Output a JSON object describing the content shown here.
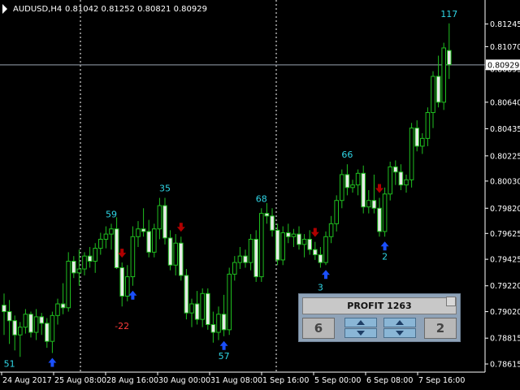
{
  "header": {
    "symbol": "AUDUSD,H4",
    "ohlc": "0.81042 0.81252 0.80821 0.80929"
  },
  "current_price": "0.80929",
  "price_axis": {
    "min": 0.78615,
    "max": 0.81305,
    "ticks": [
      "0.81245",
      "0.81070",
      "0.80895",
      "0.80640",
      "0.80435",
      "0.80225",
      "0.80030",
      "0.79820",
      "0.79625",
      "0.79425",
      "0.79220",
      "0.79020",
      "0.78815",
      "0.78615"
    ],
    "current": 0.80929
  },
  "time_axis": {
    "labels": [
      "24 Aug 2017",
      "25 Aug 08:00",
      "28 Aug 16:00",
      "30 Aug 00:00",
      "31 Aug 08:00",
      "1 Sep 16:00",
      "5 Sep 00:00",
      "6 Sep 08:00",
      "7 Sep 16:00"
    ]
  },
  "signals": [
    {
      "label": "51",
      "type": "pos",
      "bar": 1
    },
    {
      "label": "59",
      "type": "pos",
      "bar": 20
    },
    {
      "label": "-22",
      "type": "neg",
      "bar": 22
    },
    {
      "label": "35",
      "type": "pos",
      "bar": 30
    },
    {
      "label": "57",
      "type": "pos",
      "bar": 41
    },
    {
      "label": "68",
      "type": "pos",
      "bar": 48
    },
    {
      "label": "3",
      "type": "pos",
      "bar": 59
    },
    {
      "label": "66",
      "type": "pos",
      "bar": 64
    },
    {
      "label": "2",
      "type": "pos",
      "bar": 71
    },
    {
      "label": "117",
      "type": "pos",
      "bar": 83
    }
  ],
  "arrows": [
    {
      "dir": "up",
      "bar": 9
    },
    {
      "dir": "down",
      "bar": 22
    },
    {
      "dir": "up",
      "bar": 24
    },
    {
      "dir": "down",
      "bar": 33
    },
    {
      "dir": "up",
      "bar": 41
    },
    {
      "dir": "down",
      "bar": 58
    },
    {
      "dir": "up",
      "bar": 60
    },
    {
      "dir": "down",
      "bar": 70
    },
    {
      "dir": "up",
      "bar": 71
    }
  ],
  "panel": {
    "title": "PROFIT 1263",
    "left_value": "6",
    "right_value": "2"
  },
  "colors": {
    "bull": "#1fbf1f",
    "bear": "#e8e8e8",
    "wick": "#1fbf1f",
    "up_arrow": "#1a4fff",
    "down_arrow": "#b00000",
    "label_pos": "#2fd6e6",
    "label_neg": "#ff3b3b"
  },
  "chart_data": {
    "type": "candlestick",
    "candles": [
      [
        0.7907,
        0.7916,
        0.7884,
        0.7902
      ],
      [
        0.7902,
        0.7911,
        0.7877,
        0.7895
      ],
      [
        0.7895,
        0.7899,
        0.7872,
        0.7884
      ],
      [
        0.7884,
        0.7894,
        0.7867,
        0.789
      ],
      [
        0.789,
        0.7904,
        0.7885,
        0.79
      ],
      [
        0.79,
        0.7902,
        0.7882,
        0.7886
      ],
      [
        0.7886,
        0.7904,
        0.788,
        0.7898
      ],
      [
        0.7898,
        0.7901,
        0.7884,
        0.7893
      ],
      [
        0.7893,
        0.7897,
        0.7874,
        0.7879
      ],
      [
        0.7879,
        0.7902,
        0.787,
        0.7899
      ],
      [
        0.7899,
        0.7912,
        0.7892,
        0.7908
      ],
      [
        0.7908,
        0.7924,
        0.79,
        0.7905
      ],
      [
        0.7905,
        0.7948,
        0.7902,
        0.7941
      ],
      [
        0.7941,
        0.7945,
        0.7928,
        0.7932
      ],
      [
        0.7932,
        0.795,
        0.7922,
        0.7935
      ],
      [
        0.7935,
        0.7948,
        0.793,
        0.7945
      ],
      [
        0.7945,
        0.7952,
        0.7936,
        0.7941
      ],
      [
        0.7941,
        0.7955,
        0.7932,
        0.7951
      ],
      [
        0.7951,
        0.7963,
        0.7946,
        0.7958
      ],
      [
        0.7958,
        0.7968,
        0.7951,
        0.7962
      ],
      [
        0.7962,
        0.797,
        0.795,
        0.7966
      ],
      [
        0.7966,
        0.7975,
        0.7935,
        0.7936
      ],
      [
        0.7936,
        0.794,
        0.7906,
        0.7914
      ],
      [
        0.7914,
        0.7938,
        0.791,
        0.7929
      ],
      [
        0.7929,
        0.7968,
        0.7922,
        0.796
      ],
      [
        0.796,
        0.7972,
        0.7952,
        0.7966
      ],
      [
        0.7966,
        0.7982,
        0.796,
        0.7964
      ],
      [
        0.7964,
        0.7973,
        0.7944,
        0.7948
      ],
      [
        0.7948,
        0.797,
        0.7944,
        0.7966
      ],
      [
        0.7966,
        0.799,
        0.7958,
        0.7984
      ],
      [
        0.7984,
        0.799,
        0.7954,
        0.7959
      ],
      [
        0.7959,
        0.7965,
        0.7934,
        0.7938
      ],
      [
        0.7938,
        0.7962,
        0.793,
        0.7955
      ],
      [
        0.7955,
        0.796,
        0.7926,
        0.793
      ],
      [
        0.793,
        0.7935,
        0.7896,
        0.7901
      ],
      [
        0.7901,
        0.7912,
        0.789,
        0.7908
      ],
      [
        0.7908,
        0.7918,
        0.7892,
        0.7896
      ],
      [
        0.7896,
        0.792,
        0.789,
        0.7916
      ],
      [
        0.7916,
        0.792,
        0.7888,
        0.7892
      ],
      [
        0.7892,
        0.7902,
        0.7878,
        0.7886
      ],
      [
        0.7886,
        0.7906,
        0.788,
        0.79
      ],
      [
        0.79,
        0.7915,
        0.7883,
        0.7888
      ],
      [
        0.7888,
        0.7936,
        0.7884,
        0.7931
      ],
      [
        0.7931,
        0.7945,
        0.7926,
        0.794
      ],
      [
        0.794,
        0.7952,
        0.7935,
        0.7945
      ],
      [
        0.7945,
        0.795,
        0.7936,
        0.794
      ],
      [
        0.794,
        0.7962,
        0.7934,
        0.7958
      ],
      [
        0.7958,
        0.7965,
        0.7925,
        0.7929
      ],
      [
        0.7929,
        0.7982,
        0.7925,
        0.7978
      ],
      [
        0.7978,
        0.7986,
        0.797,
        0.7976
      ],
      [
        0.7976,
        0.7982,
        0.796,
        0.7965
      ],
      [
        0.7965,
        0.797,
        0.7938,
        0.7942
      ],
      [
        0.7942,
        0.7968,
        0.7938,
        0.7963
      ],
      [
        0.7963,
        0.797,
        0.7955,
        0.796
      ],
      [
        0.796,
        0.7966,
        0.7952,
        0.7962
      ],
      [
        0.7962,
        0.7968,
        0.795,
        0.7954
      ],
      [
        0.7954,
        0.7962,
        0.7944,
        0.7958
      ],
      [
        0.7958,
        0.7965,
        0.7946,
        0.795
      ],
      [
        0.795,
        0.7956,
        0.7942,
        0.7946
      ],
      [
        0.7946,
        0.7952,
        0.7936,
        0.794
      ],
      [
        0.794,
        0.7964,
        0.7938,
        0.796
      ],
      [
        0.796,
        0.7976,
        0.7955,
        0.797
      ],
      [
        0.797,
        0.7992,
        0.7964,
        0.7988
      ],
      [
        0.7988,
        0.8012,
        0.7982,
        0.8008
      ],
      [
        0.8008,
        0.8016,
        0.7992,
        0.7998
      ],
      [
        0.7998,
        0.8004,
        0.7994,
        0.8
      ],
      [
        0.8,
        0.8012,
        0.7992,
        0.8009
      ],
      [
        0.8009,
        0.8015,
        0.7978,
        0.7983
      ],
      [
        0.7983,
        0.7996,
        0.7978,
        0.7988
      ],
      [
        0.7988,
        0.8008,
        0.7978,
        0.7982
      ],
      [
        0.7982,
        0.799,
        0.796,
        0.7964
      ],
      [
        0.7964,
        0.7998,
        0.796,
        0.7993
      ],
      [
        0.7993,
        0.8018,
        0.7988,
        0.8014
      ],
      [
        0.8014,
        0.8019,
        0.8,
        0.801
      ],
      [
        0.801,
        0.8016,
        0.7996,
        0.8
      ],
      [
        0.8,
        0.8008,
        0.7994,
        0.8004
      ],
      [
        0.8004,
        0.8048,
        0.7998,
        0.8044
      ],
      [
        0.8044,
        0.805,
        0.8026,
        0.803
      ],
      [
        0.803,
        0.804,
        0.8024,
        0.8036
      ],
      [
        0.8036,
        0.806,
        0.803,
        0.8056
      ],
      [
        0.8056,
        0.8088,
        0.8044,
        0.8084
      ],
      [
        0.8084,
        0.81,
        0.806,
        0.8064
      ],
      [
        0.8064,
        0.811,
        0.8058,
        0.8106
      ],
      [
        0.8104,
        0.8125,
        0.8082,
        0.8093
      ]
    ]
  }
}
